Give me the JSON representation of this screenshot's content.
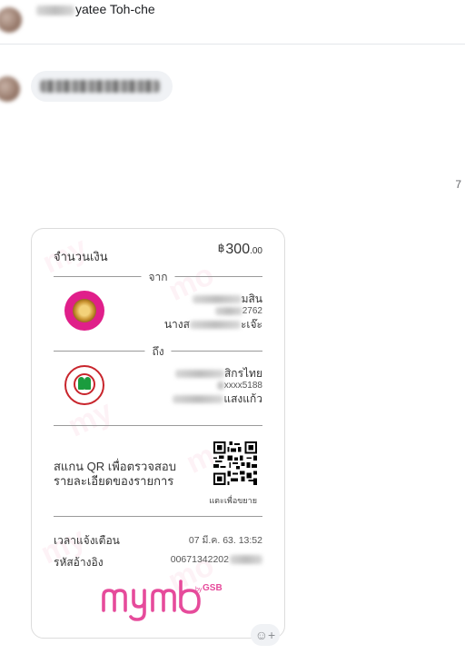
{
  "header": {
    "name_visible": "yatee Toh-che"
  },
  "timestamp_fragment": "7",
  "slip": {
    "amount_label": "จำนวนเงิน",
    "amount_currency": "฿",
    "amount_main": "300",
    "amount_decimal": ".00",
    "from_label": "จาก",
    "from": {
      "bank_line_visible": "มสิน",
      "account_visible": "2762",
      "name_prefix": "นางส",
      "name_suffix": "ะเจ๊ะ"
    },
    "to_label": "ถึง",
    "to": {
      "bank_line_visible": "สิกรไทย",
      "account_visible": "xxxx5188",
      "name_visible": "แสงแก้ว"
    },
    "qr_text_line1": "สแกน QR เพื่อตรวจสอบ",
    "qr_text_line2": "รายละเอียดของรายการ",
    "qr_caption": "แตะเพื่อขยาย",
    "datetime_label": "เวลาแจ้งเตือน",
    "datetime_value": "07 มี.ค. 63. 13:52",
    "ref_label": "รหัสอ้างอิง",
    "ref_value_visible": "00671342202",
    "brand": "mymo",
    "brand_by": "by",
    "brand_gsb": "GSB"
  },
  "react_button": {
    "icon": "add-reaction-icon",
    "glyph": "☺+"
  },
  "colors": {
    "gsb_pink": "#e01f8a",
    "mymo_pink": "#e64b9b",
    "kbank_red": "#c8252c",
    "kbank_green": "#1a9c3e",
    "bubble_gray": "#f0f2f5"
  }
}
